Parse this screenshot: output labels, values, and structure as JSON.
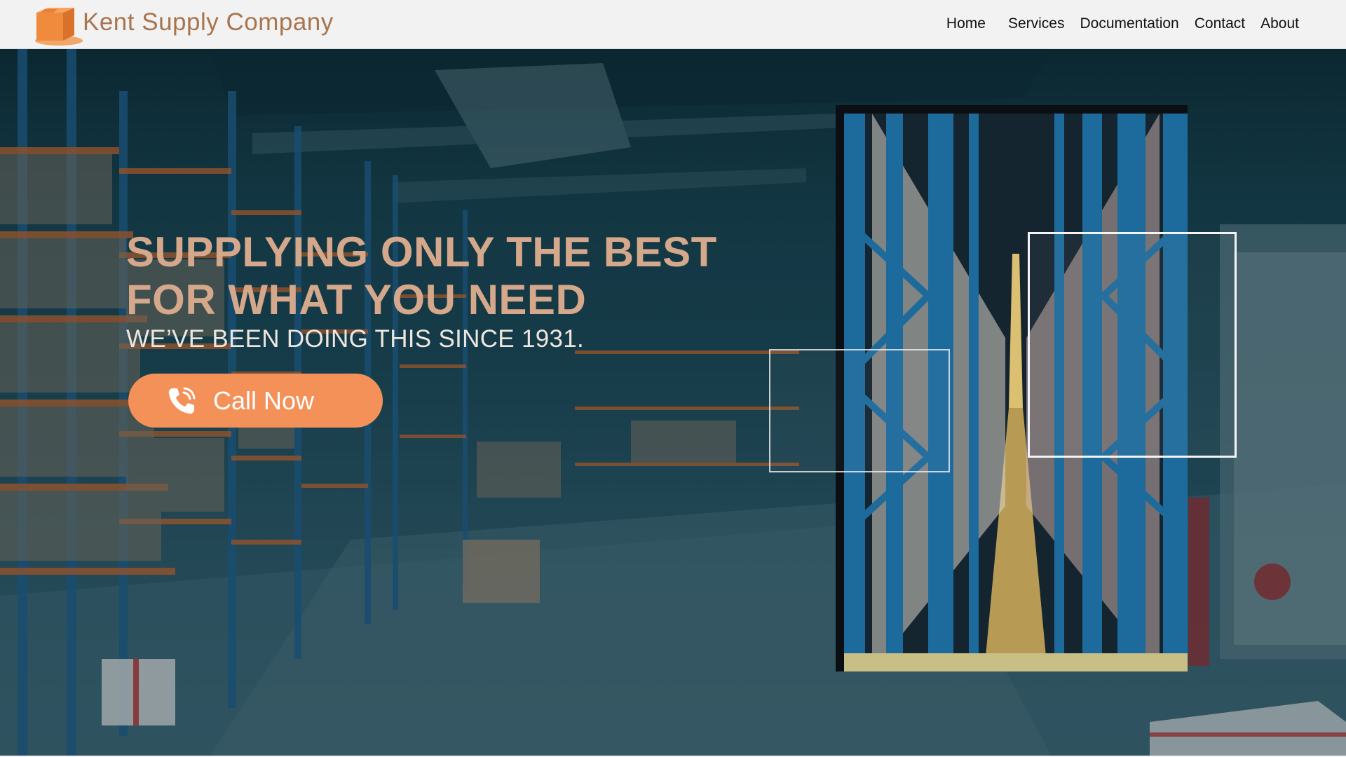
{
  "header": {
    "brand": "Kent Supply Company",
    "logo_icon": "box-logo-icon",
    "nav": [
      "Home",
      "Services",
      "Documentation",
      "Contact",
      "About"
    ]
  },
  "hero": {
    "headline_line1": "SUPPLYING ONLY THE BEST",
    "headline_line2": "FOR WHAT YOU NEED",
    "subline": "WE’VE BEEN DOING THIS SINCE 1931.",
    "cta_label": "Call Now",
    "cta_icon": "phone-icon"
  },
  "colors": {
    "brand": "#a8754e",
    "headline": "#d5a88b",
    "cta": "#f49158",
    "header_bg": "#f2f2f2"
  }
}
